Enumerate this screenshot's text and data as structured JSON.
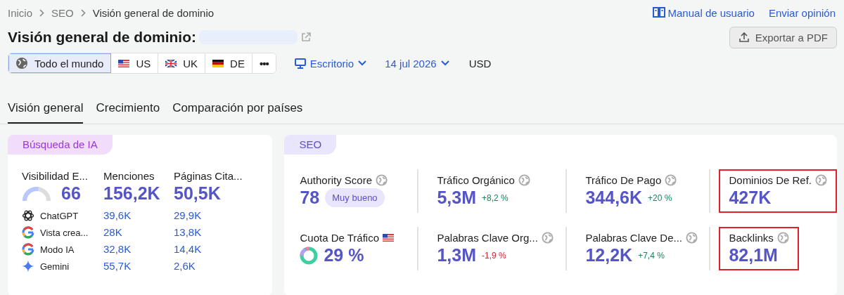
{
  "breadcrumb": [
    "Inicio",
    "SEO",
    "Visión general de dominio"
  ],
  "header_links": [
    {
      "kind": "manual",
      "label": "Manual de usuario"
    },
    {
      "kind": "plain",
      "label": "Enviar opinión"
    }
  ],
  "title": "Visión general de dominio:",
  "export_button": "Exportar a PDF",
  "regions": [
    {
      "kind": "world",
      "label": "Todo el mundo",
      "selected": true
    },
    {
      "kind": "us",
      "label": "US",
      "selected": false
    },
    {
      "kind": "uk",
      "label": "UK",
      "selected": false
    },
    {
      "kind": "de",
      "label": "DE",
      "selected": false
    },
    {
      "kind": "more",
      "label": "•••",
      "selected": false
    }
  ],
  "device": "Escritorio",
  "date": "14 jul 2026",
  "currency": "USD",
  "tabs": [
    {
      "label": "Visión general",
      "selected": true
    },
    {
      "label": "Crecimiento",
      "selected": false
    },
    {
      "label": "Comparación por países",
      "selected": false
    }
  ],
  "ai_card": {
    "tag": "Búsqueda de IA",
    "columns": [
      {
        "kind": "gauge",
        "label": "Visibilidad E...",
        "value": "66"
      },
      {
        "kind": "plain",
        "label": "Menciones",
        "value": "156,2K"
      },
      {
        "kind": "plain",
        "label": "Páginas Cita...",
        "value": "50,5K"
      }
    ],
    "rows": [
      {
        "kind": "chatgpt",
        "name": "ChatGPT",
        "mentions": "39,6K",
        "pages": "29,9K"
      },
      {
        "kind": "google",
        "name": "Vista crea...",
        "mentions": "28K",
        "pages": "13,8K"
      },
      {
        "kind": "google",
        "name": "Modo IA",
        "mentions": "32,8K",
        "pages": "14,4K"
      },
      {
        "kind": "gemini",
        "name": "Gemini",
        "mentions": "55,7K",
        "pages": "2,6K"
      }
    ]
  },
  "seo_card": {
    "tag": "SEO",
    "metrics": [
      {
        "kind": "score",
        "label": "Authority Score",
        "country_flag": false,
        "value": "78",
        "badge": "Muy bueno",
        "highlighted": false
      },
      {
        "kind": "change",
        "label": "Tráfico Orgánico",
        "country_flag": false,
        "value": "5,3M",
        "change": "+8,2 %",
        "positive": true,
        "highlighted": false
      },
      {
        "kind": "change",
        "label": "Tráfico De Pago",
        "country_flag": false,
        "value": "344,6K",
        "change": "+20 %",
        "positive": true,
        "highlighted": false
      },
      {
        "kind": "plain",
        "label": "Dominios De Ref.",
        "country_flag": false,
        "value": "427K",
        "highlighted": true
      },
      {
        "kind": "share",
        "label": "Cuota De Tráfico",
        "country_flag": true,
        "value": "29 %",
        "highlighted": false
      },
      {
        "kind": "change",
        "label": "Palabras Clave Org...",
        "country_flag": false,
        "value": "1,3M",
        "change": "-1,9 %",
        "positive": false,
        "highlighted": false
      },
      {
        "kind": "change",
        "label": "Palabras Clave De...",
        "country_flag": false,
        "value": "12,2K",
        "change": "+7,4 %",
        "positive": true,
        "highlighted": false
      },
      {
        "kind": "plain",
        "label": "Backlinks",
        "country_flag": false,
        "value": "82,1M",
        "highlighted": true
      }
    ]
  }
}
